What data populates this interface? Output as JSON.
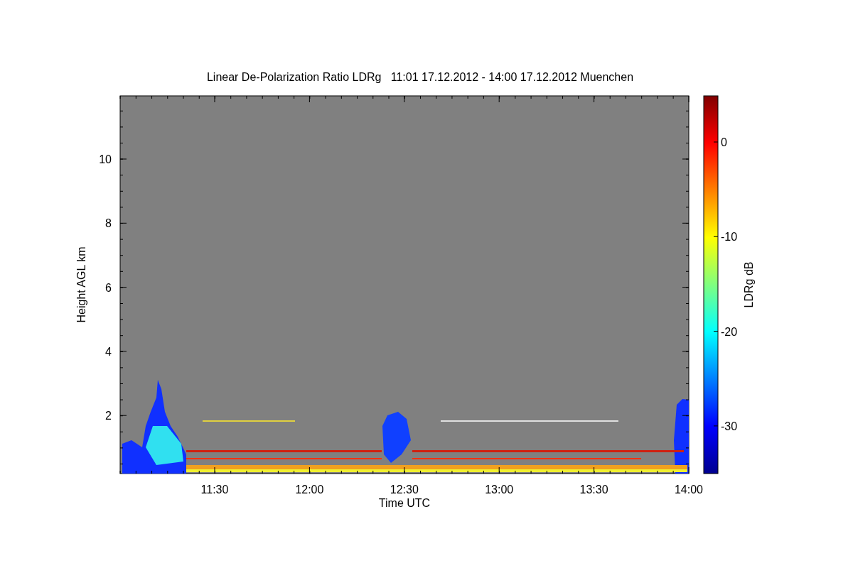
{
  "title": "Linear De-Polarization Ratio LDRg   11:01 17.12.2012 - 14:00 17.12.2012 Muenchen",
  "plot": {
    "xlabel": "Time UTC",
    "ylabel": "Height AGL km",
    "xticks": [
      "11:30",
      "12:00",
      "12:30",
      "13:00",
      "13:30",
      "14:00"
    ],
    "yticks": [
      "10",
      "8",
      "6",
      "4",
      "2"
    ]
  },
  "colorbar": {
    "label": "LDRg dB",
    "ticks": [
      "0",
      "-10",
      "-20",
      "-30"
    ]
  }
}
